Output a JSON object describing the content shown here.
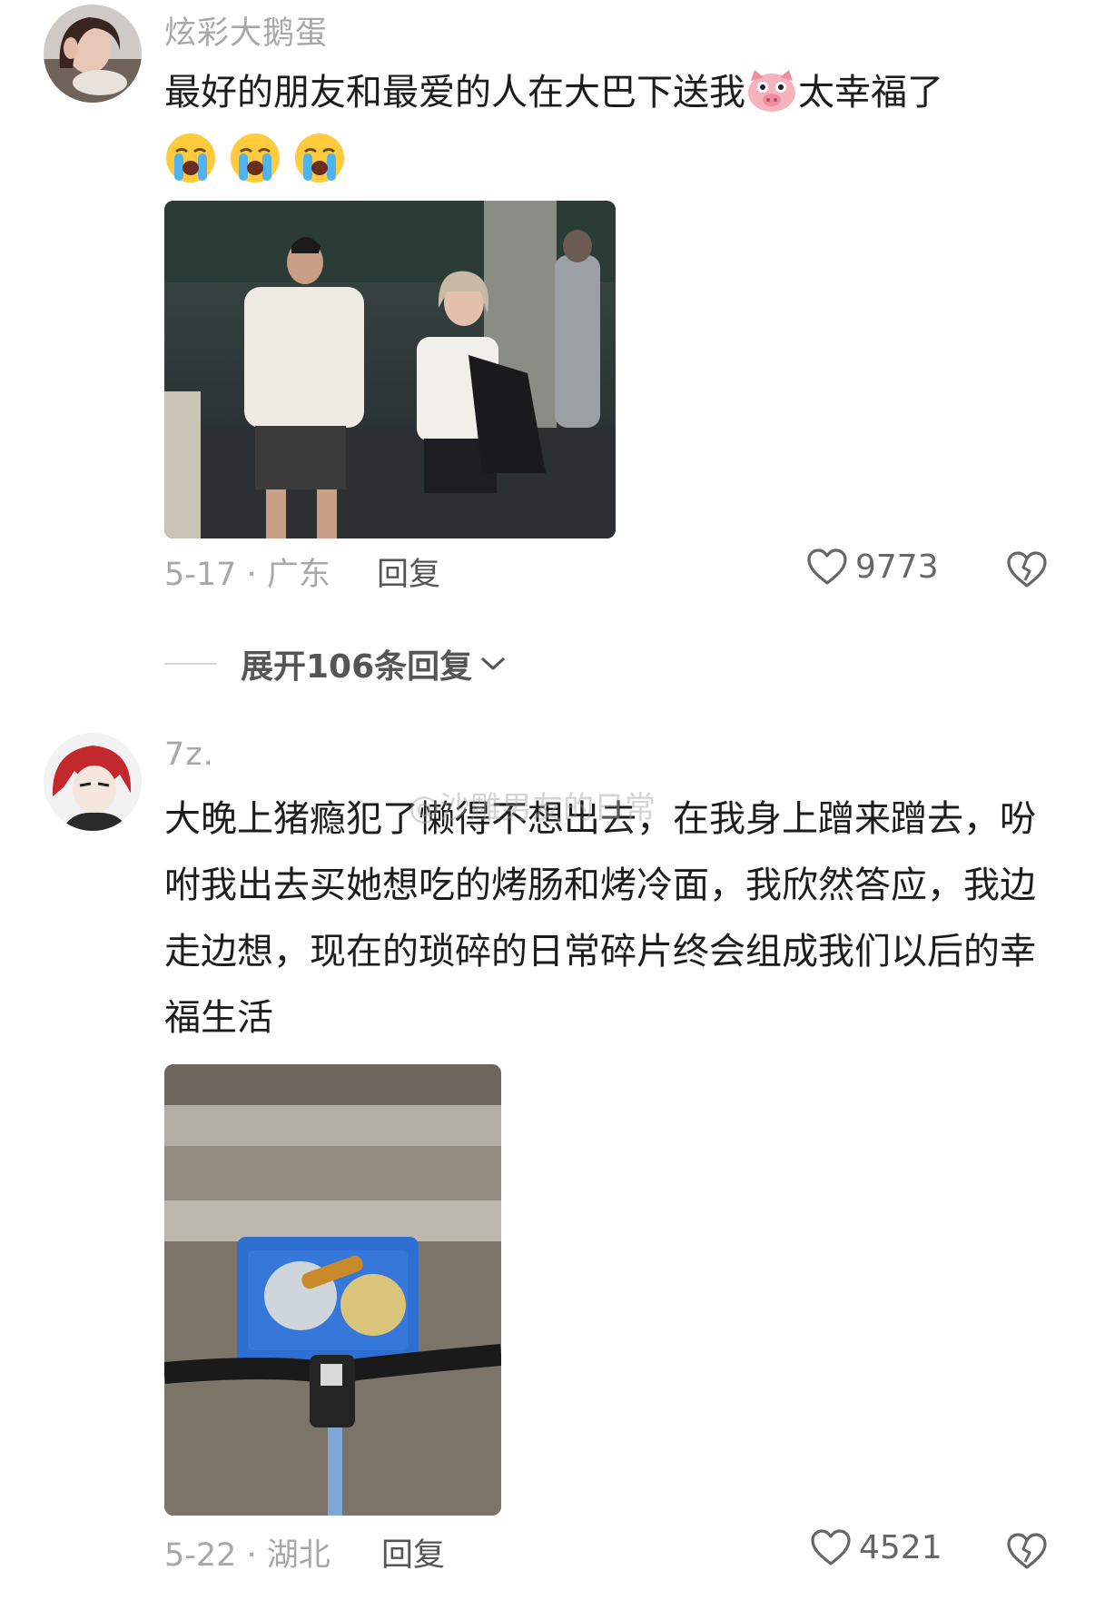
{
  "comments": [
    {
      "username": "炫彩大鹅蛋",
      "text_before_emoji": "最好的朋友和最爱的人在大巴下送我",
      "inline_emoji": "pig-face-icon",
      "text_after_emoji": "太幸福了",
      "trailing_emojis": [
        "loudly-crying-face-icon",
        "loudly-crying-face-icon",
        "loudly-crying-face-icon"
      ],
      "date_location": "5-17 · 广东",
      "reply_label": "回复",
      "like_count": "9773"
    },
    {
      "username": "7z.",
      "text": "大晚上猪瘾犯了懒得不想出去，在我身上蹭来蹭去，吩咐我出去买她想吃的烤肠和烤冷面，我欣然答应，我边走边想，现在的琐碎的日常碎片终会组成我们以后的幸福生活",
      "date_location": "5-22 · 湖北",
      "reply_label": "回复",
      "like_count": "4521"
    }
  ],
  "expand_replies": {
    "label": "展开106条回复"
  },
  "watermark": "@沙雕男友的日常",
  "colors": {
    "secondary_text": "#a8a8a8",
    "body_text": "#1c1c1c",
    "divider": "#d8d8d8"
  }
}
